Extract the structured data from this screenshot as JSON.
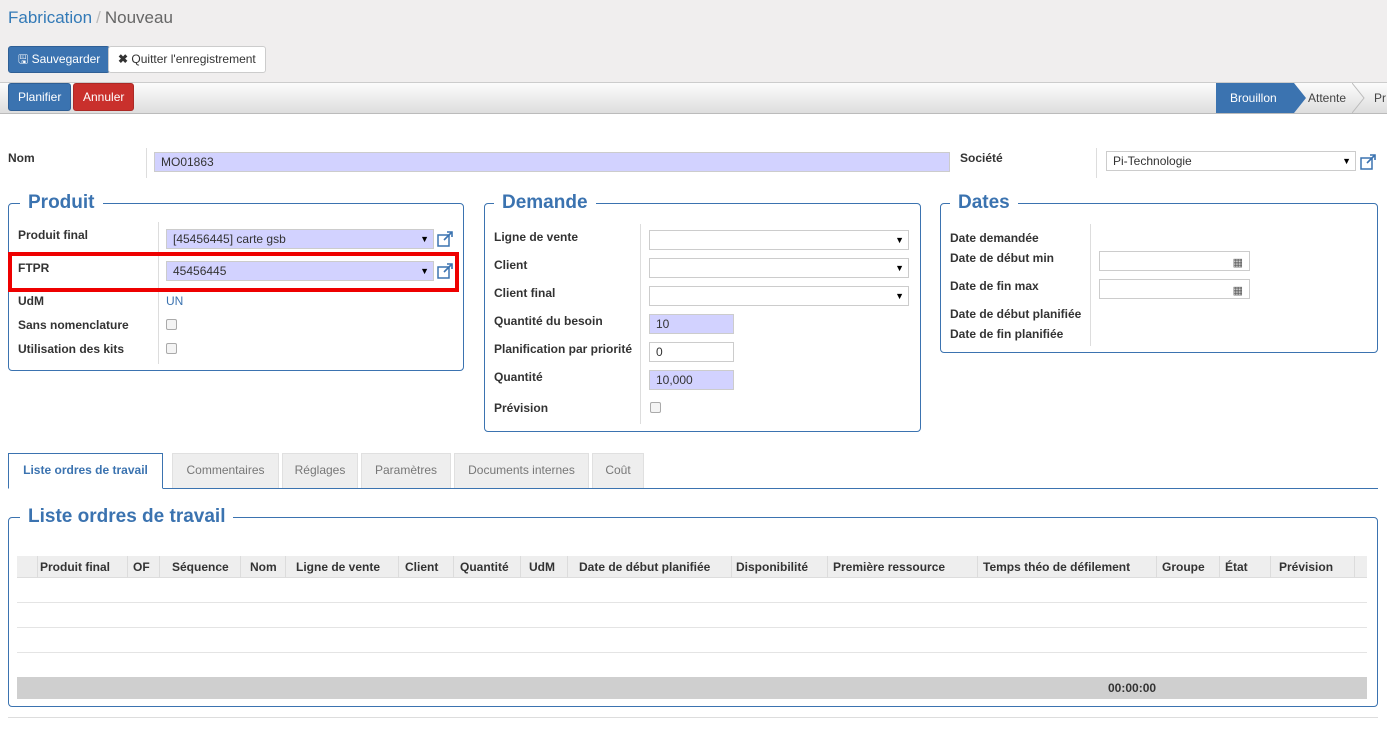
{
  "breadcrumb": {
    "parent": "Fabrication",
    "separator": "/",
    "current": "Nouveau"
  },
  "toolbar": {
    "save_label": "Sauvegarder",
    "discard_label": "Quitter l'enregistrement"
  },
  "header_buttons": {
    "plan_label": "Planifier",
    "cancel_label": "Annuler"
  },
  "status": {
    "stages": [
      "Brouillon",
      "Attente",
      "Pr"
    ],
    "active": "Brouillon"
  },
  "main": {
    "name_label": "Nom",
    "name_value": "MO01863",
    "company_label": "Société",
    "company_value": "Pi-Technologie"
  },
  "produit": {
    "title": "Produit",
    "final_label": "Produit final",
    "final_value": "[45456445] carte gsb",
    "ftpr_label": "FTPR",
    "ftpr_value": "45456445",
    "udm_label": "UdM",
    "udm_value": "UN",
    "sans_nomenclature_label": "Sans nomenclature",
    "kits_label": "Utilisation des kits"
  },
  "demande": {
    "title": "Demande",
    "ligne_label": "Ligne de vente",
    "ligne_value": "",
    "client_label": "Client",
    "client_value": "",
    "client_final_label": "Client final",
    "client_final_value": "",
    "qte_besoin_label": "Quantité du besoin",
    "qte_besoin_value": "10",
    "priorite_label": "Planification par priorité",
    "priorite_value": "0",
    "quantite_label": "Quantité",
    "quantite_value": "10,000",
    "prevision_label": "Prévision"
  },
  "dates": {
    "title": "Dates",
    "demandee_label": "Date demandée",
    "debut_min_label": "Date de début min",
    "fin_max_label": "Date de fin max",
    "debut_planifiee_label": "Date de début planifiée",
    "fin_planifiee_label": "Date de fin planifiée"
  },
  "tabs": [
    "Liste ordres de travail",
    "Commentaires",
    "Réglages",
    "Paramètres",
    "Documents internes",
    "Coût"
  ],
  "work_orders": {
    "title": "Liste ordres de travail",
    "columns": [
      "Produit final",
      "OF",
      "Séquence",
      "Nom",
      "Ligne de vente",
      "Client",
      "Quantité",
      "UdM",
      "Date de début planifiée",
      "Disponibilité",
      "Première ressource",
      "Temps théo de défilement",
      "Groupe",
      "État",
      "Prévision"
    ],
    "total": "00:00:00"
  },
  "colors": {
    "primary": "#3b73b0",
    "danger": "#c9302c",
    "required_field": "#d2d2ff",
    "highlight": "#ee0000"
  }
}
